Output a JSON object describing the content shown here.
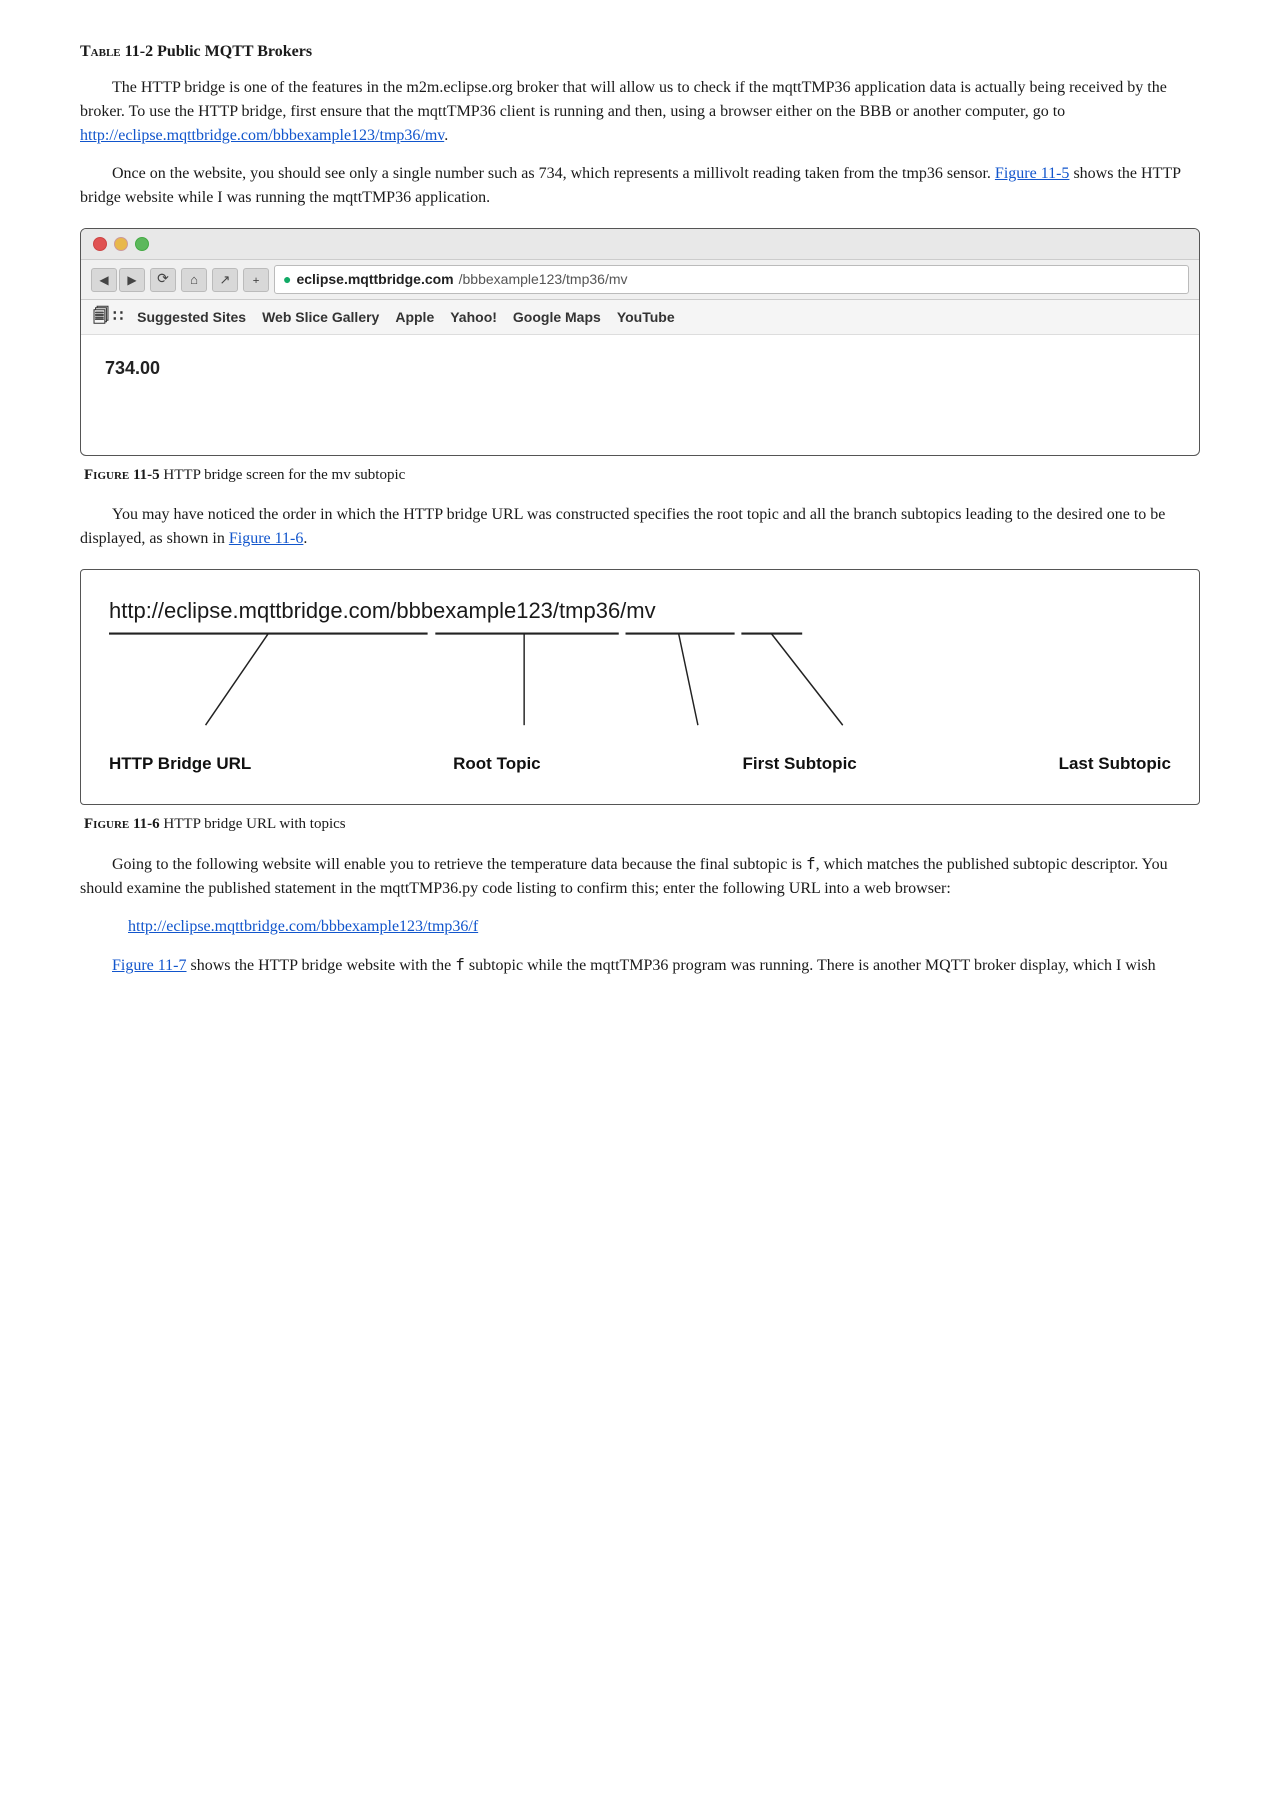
{
  "table_heading": {
    "label": "Table 11-2",
    "text": " Public MQTT Brokers"
  },
  "paragraph1": "The HTTP bridge is one of the features in the m2m.eclipse.org broker that will allow us to check if the mqttTMP36 application data is actually being received by the broker. To use the HTTP bridge, first ensure that the mqttTMP36 client is running and then, using a browser either on the BBB or another computer, go to",
  "link1": {
    "text": "http://eclipse.mqttbridge.com/bbbexample123/tmp36/mv",
    "href": "http://eclipse.mqttbridge.com/bbbexample123/tmp36/mv"
  },
  "paragraph2": "Once on the website, you should see only a single number such as 734, which represents a millivolt reading taken from the tmp36 sensor.",
  "figure5_ref_text": "Figure 11-5",
  "paragraph2b": " shows the HTTP bridge website while I was running the mqttTMP36 application.",
  "browser": {
    "address": {
      "domain": "eclipse.mqttbridge.com",
      "path": "/bbbexample123/tmp36/mv"
    },
    "bookmarks": [
      "Suggested Sites",
      "Web Slice Gallery",
      "Apple",
      "Yahoo!",
      "Google Maps",
      "YouTube"
    ],
    "content_value": "734.00"
  },
  "figure5_caption": {
    "label": "Figure 11-5",
    "text": " HTTP bridge screen for the mv subtopic"
  },
  "paragraph3": "You may have noticed the order in which the HTTP bridge URL was constructed specifies the root topic and all the branch subtopics leading to the desired one to be displayed, as shown in",
  "figure6_ref_text": "Figure 11-6",
  "paragraph3b": ".",
  "diagram": {
    "url": "http://eclipse.mqttbridge.com/bbbexample123/tmp36/mv",
    "labels": {
      "http_bridge": "HTTP Bridge URL",
      "root_topic": "Root Topic",
      "first_subtopic": "First Subtopic",
      "last_subtopic": "Last Subtopic"
    }
  },
  "figure6_caption": {
    "label": "Figure 11-6",
    "text": " HTTP bridge URL with topics"
  },
  "paragraph4": "Going to the following website will enable you to retrieve the temperature data because the final subtopic is",
  "code1": "f",
  "paragraph4b": ", which matches the published subtopic descriptor. You should examine the published statement in the mqttTMP36.py code listing to confirm this; enter the following URL into a web browser:",
  "link2": {
    "text": "http://eclipse.mqttbridge.com/bbbexample123/tmp36/f",
    "href": "http://eclipse.mqttbridge.com/bbbexample123/tmp36/f"
  },
  "figure7_ref_text": "Figure 11-7",
  "paragraph5": " shows the HTTP bridge website with the",
  "code2": "f",
  "paragraph5b": "subtopic while the mqttTMP36 program was running. There is another MQTT broker display, which I wish"
}
